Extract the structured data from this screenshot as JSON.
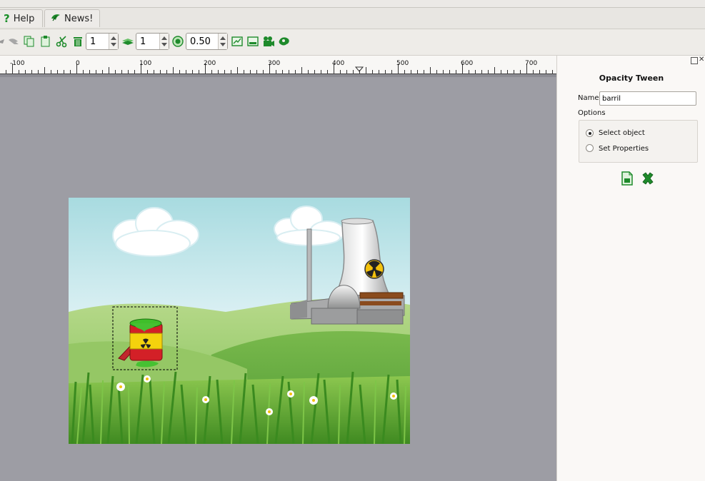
{
  "tabs": [
    {
      "label": "Help",
      "icon": "question-icon"
    },
    {
      "label": "News!",
      "icon": "leaf-icon"
    }
  ],
  "toolbar": {
    "spin1_value": "1",
    "spin2_value": "1",
    "opacity_value": "0.50"
  },
  "ruler": {
    "labels": [
      "-100",
      "0",
      "100",
      "200",
      "300",
      "400",
      "500",
      "600",
      "700"
    ]
  },
  "panel": {
    "title": "Opacity Tween",
    "name_label": "Name:",
    "name_value": "barril",
    "options_label": "Options",
    "options": [
      {
        "label": "Select object",
        "selected": true
      },
      {
        "label": "Set Properties",
        "selected": false
      }
    ]
  },
  "colors": {
    "accent_green": "#1e9a2e",
    "workspace": "#9d9da4"
  }
}
